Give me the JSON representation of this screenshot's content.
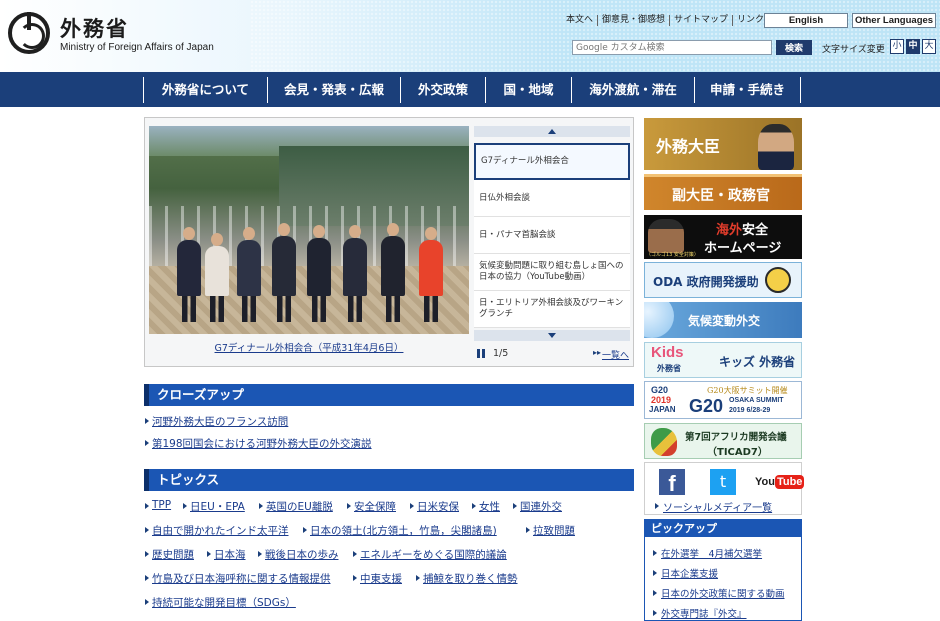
{
  "header": {
    "logo_ja": "外務省",
    "logo_en": "Ministry of Foreign Affairs of Japan",
    "util_links": [
      "本文へ",
      "御意見・御感想",
      "サイトマップ",
      "リンク集"
    ],
    "lang_english": "English",
    "lang_other": "Other Languages",
    "search_placeholder": "Google カスタム検索",
    "search_button": "検索",
    "font_size_label": "文字サイズ変更",
    "font_sizes": [
      "小",
      "中",
      "大"
    ]
  },
  "nav": {
    "items": [
      "外務省について",
      "会見・発表・広報",
      "外交政策",
      "国・地域",
      "海外渡航・滞在",
      "申請・手続き"
    ]
  },
  "slideshow": {
    "caption": "G7ディナール外相会合（平成31年4月6日）",
    "thumbs": [
      "G7ディナール外相会合",
      "日仏外相会談",
      "日・パナマ首脳会談",
      "気候変動問題に取り組む島しょ国への日本の協力（YouTube動画）",
      "日・エリトリア外相会談及びワーキングランチ"
    ],
    "page_count": "1/5",
    "list_link": "一覧へ"
  },
  "closeup": {
    "title": "クローズアップ",
    "links": [
      "河野外務大臣のフランス訪問",
      "第198回国会における河野外務大臣の外交演説"
    ]
  },
  "topics": {
    "title": "トピックス",
    "rows": [
      [
        "TPP",
        "日EU・EPA",
        "英国のEU離脱",
        "安全保障",
        "日米安保",
        "女性",
        "国連外交"
      ],
      [
        "自由で開かれたインド太平洋",
        "日本の領土(北方領土，竹島，尖閣諸島)",
        "拉致問題"
      ],
      [
        "歴史問題",
        "日本海",
        "戦後日本の歩み",
        "エネルギーをめぐる国際的議論"
      ],
      [
        "竹島及び日本海呼称に関する情報提供",
        "中東支援",
        "捕鯨を取り巻く情勢"
      ],
      [
        "持続可能な開発目標（SDGs）"
      ]
    ]
  },
  "banners": {
    "minister": "外務大臣",
    "vice": "副大臣・政務官",
    "safety_line1_a": "海外",
    "safety_line1_b": "安全",
    "safety_line2": "ホームページ",
    "safety_sub": "（ゴルゴ13 安全対策）",
    "oda": "ODA 政府開発援助",
    "climate": "気候変動外交",
    "kids_logo": "Kids",
    "kids_sub": "外務省",
    "kids_title": "キッズ 外務省",
    "g20_line1": "G20大阪サミット開催",
    "g20_line2": "OSAKA SUMMIT",
    "g20_line3": "2019 6/28-29",
    "g20_badge_a": "G20",
    "g20_badge_b": "2019",
    "g20_badge_c": "JAPAN",
    "g20_big": "G20",
    "ticad_line1": "第7回アフリカ開発会議",
    "ticad_line2": "（TICAD7）"
  },
  "social": {
    "facebook": "f",
    "twitter": "t",
    "youtube_a": "You",
    "youtube_b": "Tube",
    "link": "ソーシャルメディア一覧"
  },
  "pickup": {
    "title": "ピックアップ",
    "items": [
      "在外選挙　4月補欠選挙",
      "日本企業支援",
      "日本の外交政策に関する動画",
      "外交専門誌『外交』"
    ]
  },
  "colors": {
    "nav_bg": "#1b3f7a",
    "section_bar": "#1b56b4",
    "link": "#1a3b8c",
    "minister_gold": "#c99a3c",
    "vice_orange": "#d0862c"
  }
}
